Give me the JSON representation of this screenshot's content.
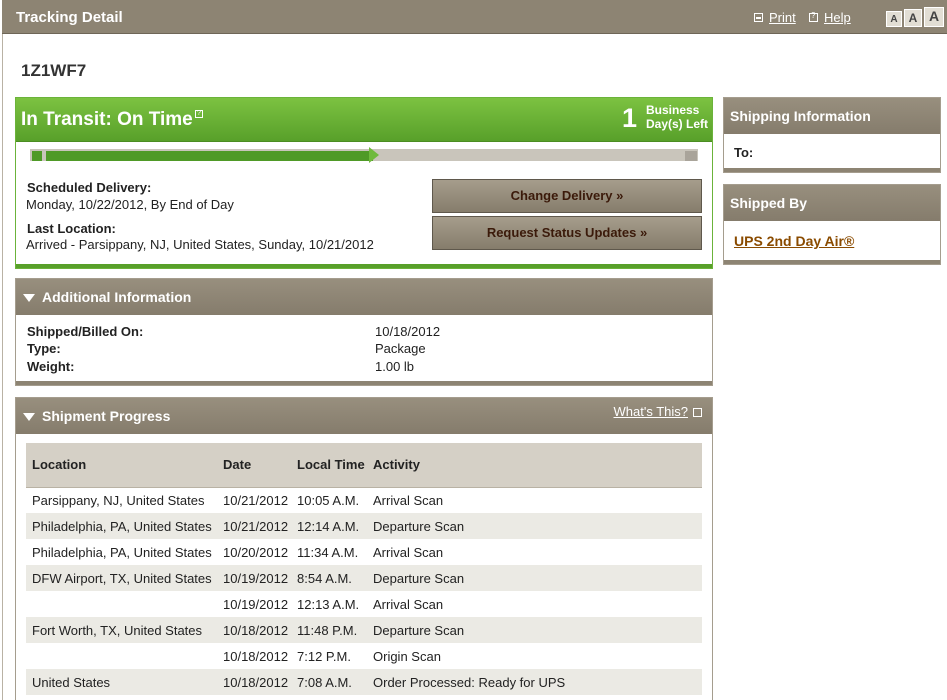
{
  "titlebar": {
    "title": "Tracking Detail",
    "print_label": "Print",
    "help_label": "Help",
    "font_sizes": [
      "A",
      "A",
      "A"
    ]
  },
  "tracking_number": "1Z1WF7",
  "status": {
    "title": "In Transit: On Time",
    "days_left": "1",
    "days_left_label_1": "Business",
    "days_left_label_2": "Day(s) Left",
    "progress": 0.49,
    "scheduled_delivery_label": "Scheduled Delivery:",
    "scheduled_delivery_value": "Monday, 10/22/2012, By End of Day",
    "last_location_label": "Last Location:",
    "last_location_value": "Arrived - Parsippany, NJ, United States, Sunday, 10/21/2012",
    "change_delivery_label": "Change Delivery »",
    "request_updates_label": "Request Status Updates »"
  },
  "additional_info": {
    "title": "Additional Information",
    "shipped_billed_label": "Shipped/Billed On:",
    "shipped_billed_value": "10/18/2012",
    "type_label": "Type:",
    "type_value": "Package",
    "weight_label": "Weight:",
    "weight_value": "1.00 lb"
  },
  "shipment_progress": {
    "title": "Shipment Progress",
    "whats_this": "What's This?",
    "columns": [
      "Location",
      "Date",
      "Local Time",
      "Activity"
    ],
    "rows": [
      {
        "location": "Parsippany, NJ, United States",
        "date": "10/21/2012",
        "time": "10:05 A.M.",
        "activity": "Arrival Scan"
      },
      {
        "location": "Philadelphia, PA, United States",
        "date": "10/21/2012",
        "time": "12:14 A.M.",
        "activity": "Departure Scan"
      },
      {
        "location": "Philadelphia, PA, United States",
        "date": "10/20/2012",
        "time": "11:34 A.M.",
        "activity": "Arrival Scan"
      },
      {
        "location": "DFW Airport, TX, United States",
        "date": "10/19/2012",
        "time": "8:54 A.M.",
        "activity": "Departure Scan"
      },
      {
        "location": "",
        "date": "10/19/2012",
        "time": "12:13 A.M.",
        "activity": "Arrival Scan"
      },
      {
        "location": "Fort Worth, TX, United States",
        "date": "10/18/2012",
        "time": "11:48 P.M.",
        "activity": "Departure Scan"
      },
      {
        "location": "",
        "date": "10/18/2012",
        "time": "7:12 P.M.",
        "activity": "Origin Scan"
      },
      {
        "location": "United States",
        "date": "10/18/2012",
        "time": "7:08 A.M.",
        "activity": "Order Processed: Ready for UPS"
      }
    ]
  },
  "shipping_information": {
    "title": "Shipping Information",
    "to_label": "To:"
  },
  "shipped_by": {
    "title": "Shipped By",
    "service_link": "UPS 2nd Day Air®"
  },
  "colors": {
    "status_green": "#6bb33a",
    "panel_brown": "#8d8473",
    "link_brown": "#8a4b00"
  },
  "icons": [
    "printer-icon",
    "help-icon",
    "info-icon",
    "collapse-triangle-icon"
  ]
}
